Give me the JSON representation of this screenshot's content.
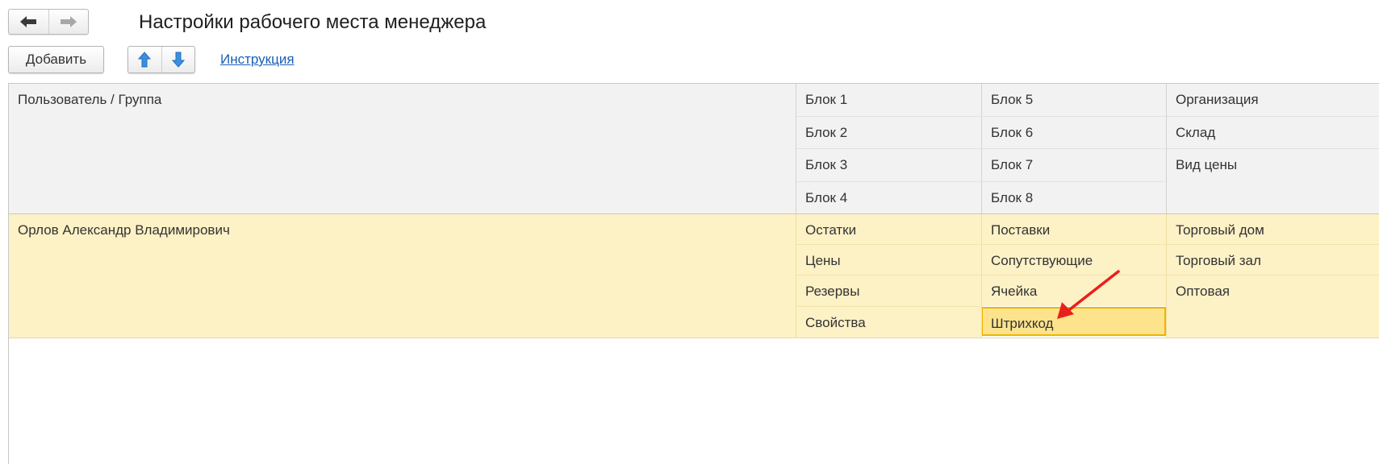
{
  "window": {
    "title": "Настройки рабочего места менеджера"
  },
  "toolbar": {
    "add_label": "Добавить",
    "instruction_link": "Инструкция"
  },
  "table": {
    "header": {
      "user_group": "Пользователь / Группа",
      "col2": [
        "Блок 1",
        "Блок 2",
        "Блок 3",
        "Блок 4"
      ],
      "col3": [
        "Блок 5",
        "Блок 6",
        "Блок 7",
        "Блок 8"
      ],
      "col4": [
        "Организация",
        "Склад",
        "Вид цены"
      ]
    },
    "rows": [
      {
        "user": "Орлов Александр Владимирович",
        "col2": [
          "Остатки",
          "Цены",
          "Резервы",
          "Свойства"
        ],
        "col3": [
          "Поставки",
          "Сопутствующие",
          "Ячейка",
          "Штрихкод"
        ],
        "col4": [
          "Торговый дом",
          "Торговый зал",
          "Оптовая"
        ]
      }
    ]
  },
  "colors": {
    "row_highlight": "#fdf1c6",
    "selected_cell": "#fde38c",
    "selected_border": "#f0b400",
    "annotation_arrow": "#e8211b",
    "link": "#1a5fb4"
  }
}
